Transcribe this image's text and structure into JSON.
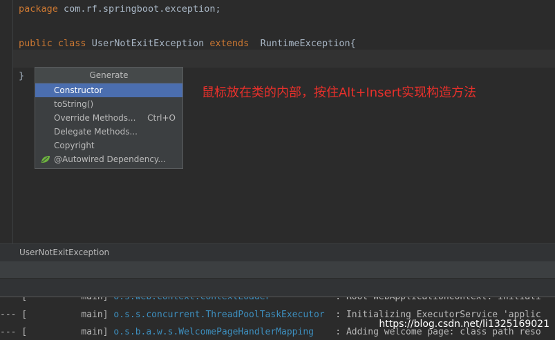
{
  "code": {
    "line1": {
      "keyword": "package",
      "text": " com.rf.springboot.exception;"
    },
    "line2": {
      "kw_public": "public",
      "kw_class": "class",
      "class_name": "UserNotExitException",
      "kw_extends": "extends",
      "super": "RuntimeException{"
    },
    "line3": {
      "text": "}"
    }
  },
  "generate_menu": {
    "title": "Generate",
    "items": [
      {
        "label": "Constructor",
        "shortcut": ""
      },
      {
        "label": "toString()",
        "shortcut": ""
      },
      {
        "label": "Override Methods...",
        "shortcut": "Ctrl+O"
      },
      {
        "label": "Delegate Methods...",
        "shortcut": ""
      },
      {
        "label": "Copyright",
        "shortcut": ""
      },
      {
        "label": "@Autowired Dependency...",
        "shortcut": ""
      }
    ]
  },
  "annotation": "鼠标放在类的内部，按住Alt+Insert实现构造方法",
  "breadcrumb": "UserNotExitException",
  "console": {
    "lines": [
      {
        "prefix": "--- [",
        "thread": "main]",
        "logger": "o.s.web.context.ContextLoader",
        "message": ": Root WebApplicationContext: initiali"
      },
      {
        "prefix": "--- [",
        "thread": "main]",
        "logger": "o.s.s.concurrent.ThreadPoolTaskExecutor",
        "message": ": Initializing ExecutorService 'applic"
      },
      {
        "prefix": "--- [",
        "thread": "main]",
        "logger": "o.s.b.a.w.s.WelcomePageHandlerMapping",
        "message": ": Adding welcome page: class path reso"
      }
    ]
  },
  "watermark": "https://blog.csdn.net/li1325169021",
  "colors": {
    "keyword": "#cc7832",
    "selection": "#4b6eaf",
    "annotation": "#e8302b",
    "logger": "#3d8fbf"
  }
}
